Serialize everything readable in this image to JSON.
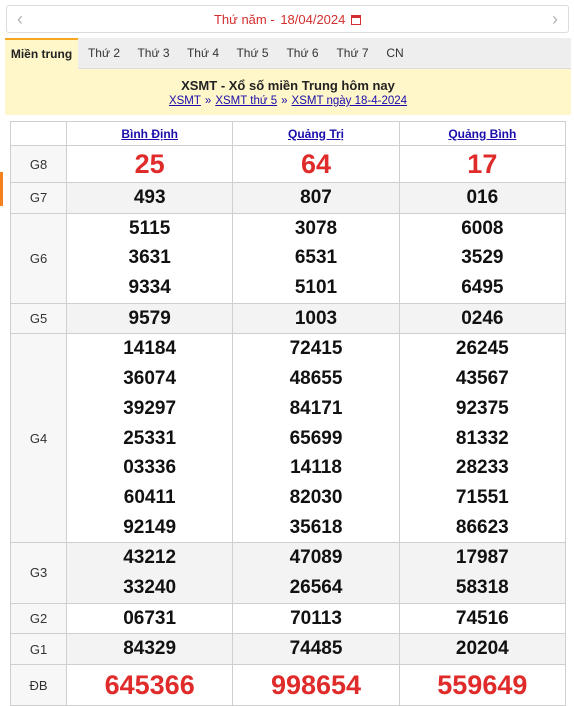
{
  "datebar": {
    "weekday": "Thứ năm -",
    "date": "18/04/2024",
    "prev_glyph": "‹",
    "next_glyph": "›"
  },
  "tabs": [
    {
      "label": "Miền trung",
      "active": true
    },
    {
      "label": "Thứ 2"
    },
    {
      "label": "Thứ 3"
    },
    {
      "label": "Thứ 4"
    },
    {
      "label": "Thứ 5"
    },
    {
      "label": "Thứ 6"
    },
    {
      "label": "Thứ 7"
    },
    {
      "label": "CN"
    }
  ],
  "header": {
    "title": "XSMT - Xổ số miền Trung hôm nay",
    "crumbs": [
      "XSMT",
      "XSMT thứ 5",
      "XSMT ngày 18-4-2024"
    ],
    "separator": "»"
  },
  "provinces": [
    "Bình Định",
    "Quảng Trị",
    "Quảng Bình"
  ],
  "prizes": [
    {
      "label": "G8",
      "values": [
        [
          "25"
        ],
        [
          "64"
        ],
        [
          "17"
        ]
      ]
    },
    {
      "label": "G7",
      "values": [
        [
          "493"
        ],
        [
          "807"
        ],
        [
          "016"
        ]
      ]
    },
    {
      "label": "G6",
      "values": [
        [
          "5115",
          "3631",
          "9334"
        ],
        [
          "3078",
          "6531",
          "5101"
        ],
        [
          "6008",
          "3529",
          "6495"
        ]
      ]
    },
    {
      "label": "G5",
      "values": [
        [
          "9579"
        ],
        [
          "1003"
        ],
        [
          "0246"
        ]
      ]
    },
    {
      "label": "G4",
      "values": [
        [
          "14184",
          "36074",
          "39297",
          "25331",
          "03336",
          "60411",
          "92149"
        ],
        [
          "72415",
          "48655",
          "84171",
          "65699",
          "14118",
          "82030",
          "35618"
        ],
        [
          "26245",
          "43567",
          "92375",
          "81332",
          "28233",
          "71551",
          "86623"
        ]
      ]
    },
    {
      "label": "G3",
      "values": [
        [
          "43212",
          "33240"
        ],
        [
          "47089",
          "26564"
        ],
        [
          "17987",
          "58318"
        ]
      ]
    },
    {
      "label": "G2",
      "values": [
        [
          "06731"
        ],
        [
          "70113"
        ],
        [
          "74516"
        ]
      ]
    },
    {
      "label": "G1",
      "values": [
        [
          "84329"
        ],
        [
          "74485"
        ],
        [
          "20204"
        ]
      ]
    },
    {
      "label": "ĐB",
      "values": [
        [
          "645366"
        ],
        [
          "998654"
        ],
        [
          "559649"
        ]
      ]
    }
  ],
  "colors": {
    "accent": "#e02b2b",
    "tab_active_bg": "#fff6c9",
    "link": "#1a0dab"
  }
}
